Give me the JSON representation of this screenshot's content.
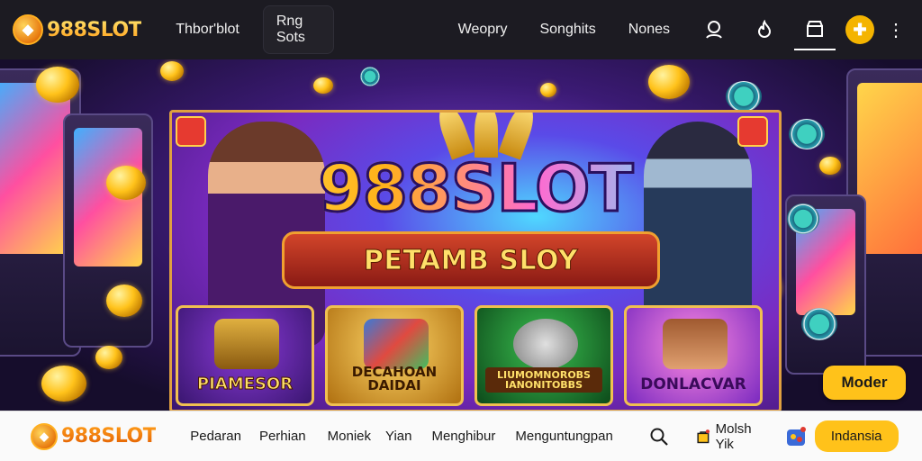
{
  "brand": {
    "name": "988SLOT",
    "coin_glyph": "◆"
  },
  "topbar": {
    "nav": [
      {
        "label": "Thbor'blot"
      },
      {
        "label": "Rng Sots"
      },
      {
        "label": "Weopry"
      },
      {
        "label": "Songhits"
      },
      {
        "label": "Nones"
      }
    ],
    "icons": [
      "user-icon",
      "fire-icon",
      "store-icon",
      "game-icon",
      "more-icon"
    ]
  },
  "hero": {
    "title": "988SLOT",
    "subtitle": "PETAMB SLOY",
    "cards": [
      {
        "label": "PIAMESOR"
      },
      {
        "label": "DECAHOAN DAIDAI"
      },
      {
        "label": "LIUMOMNOROBS IANONITOBBS"
      },
      {
        "label": "DONLACVAR"
      }
    ],
    "cta_label": "Moder"
  },
  "bottombar": {
    "nav": [
      {
        "label": "Pedaran"
      },
      {
        "label": "Perhian"
      },
      {
        "label": "Moniek"
      },
      {
        "label": "Yian"
      },
      {
        "label": "Menghibur"
      },
      {
        "label": "Menguntungpan"
      }
    ],
    "cart_label": "Molsh Yik",
    "lang_label": "Indansia"
  },
  "colors": {
    "accent": "#ffc21a",
    "topbar_bg": "#1c1b22",
    "bottombar_bg": "#fafafa"
  }
}
